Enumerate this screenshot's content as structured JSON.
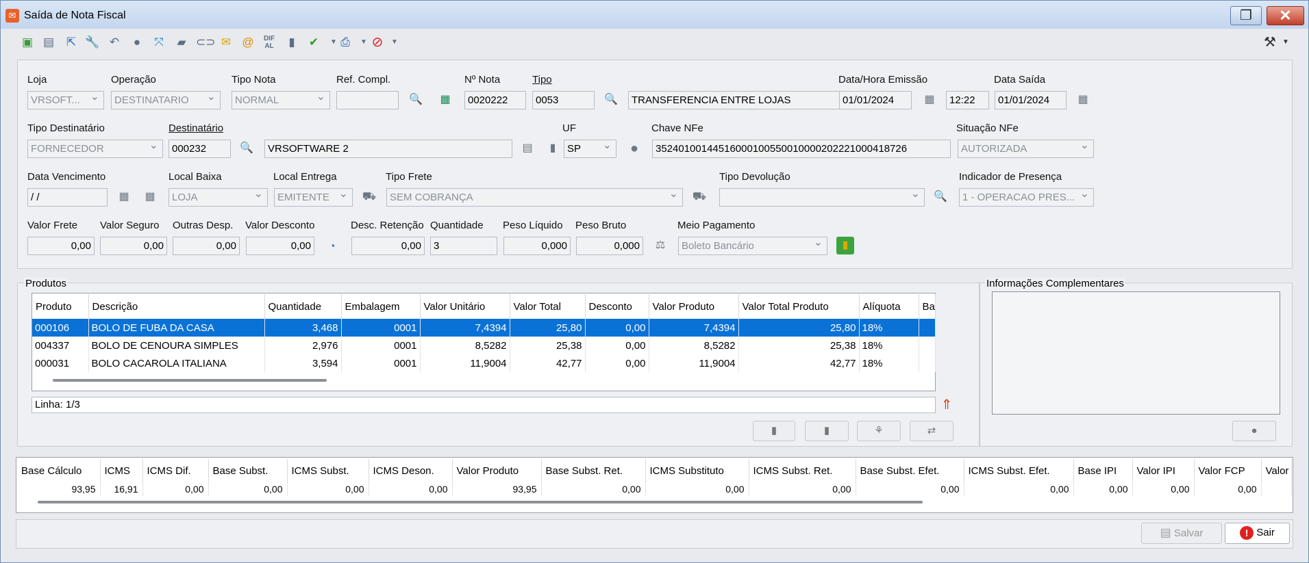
{
  "window": {
    "title": "Saída de Nota Fiscal"
  },
  "header": {
    "loja": {
      "label": "Loja",
      "value": "VRSOFT..."
    },
    "operacao": {
      "label": "Operação",
      "value": "DESTINATARIO"
    },
    "tipo_nota": {
      "label": "Tipo Nota",
      "value": "NORMAL"
    },
    "ref_compl": {
      "label": "Ref. Compl.",
      "value": ""
    },
    "numero_nota": {
      "label": "Nº Nota",
      "value": "0020222"
    },
    "tipo": {
      "label": "Tipo",
      "code": "0053",
      "description": "TRANSFERENCIA ENTRE LOJAS"
    },
    "data_hora_emissao": {
      "label": "Data/Hora Emissão",
      "date": "01/01/2024",
      "time": "12:22"
    },
    "data_saida": {
      "label": "Data Saída",
      "value": "01/01/2024"
    },
    "tipo_destinatario": {
      "label": "Tipo Destinatário",
      "value": "FORNECEDOR"
    },
    "destinatario": {
      "label": "Destinatário",
      "code": "000232",
      "name": "VRSOFTWARE 2"
    },
    "uf": {
      "label": "UF",
      "value": "SP"
    },
    "chave_nfe": {
      "label": "Chave NFe",
      "value": "35240100144516000100550010000202221000418726"
    },
    "situacao_nfe": {
      "label": "Situação NFe",
      "value": "AUTORIZADA"
    },
    "data_vencimento": {
      "label": "Data Vencimento",
      "value": " / /"
    },
    "local_baixa": {
      "label": "Local Baixa",
      "value": "LOJA"
    },
    "local_entrega": {
      "label": "Local Entrega",
      "value": "EMITENTE"
    },
    "tipo_frete": {
      "label": "Tipo Frete",
      "value": "SEM COBRANÇA"
    },
    "tipo_devolucao": {
      "label": "Tipo Devolução",
      "value": ""
    },
    "indicador_presenca": {
      "label": "Indicador de Presença",
      "value": "1 - OPERACAO PRES..."
    },
    "valor_frete": {
      "label": "Valor Frete",
      "value": "0,00"
    },
    "valor_seguro": {
      "label": "Valor Seguro",
      "value": "0,00"
    },
    "outras_desp": {
      "label": "Outras Desp.",
      "value": "0,00"
    },
    "valor_desconto": {
      "label": "Valor Desconto",
      "value": "0,00"
    },
    "desc_retencao": {
      "label": "Desc. Retenção",
      "value": "0,00"
    },
    "quantidade": {
      "label": "Quantidade",
      "value": "3"
    },
    "peso_liquido": {
      "label": "Peso Líquido",
      "value": "0,000"
    },
    "peso_bruto": {
      "label": "Peso Bruto",
      "value": "0,000"
    },
    "meio_pagamento": {
      "label": "Meio Pagamento",
      "value": "Boleto Bancário"
    }
  },
  "produtos": {
    "title": "Produtos",
    "columns": [
      "Produto",
      "Descrição",
      "Quantidade",
      "Embalagem",
      "Valor Unitário",
      "Valor Total",
      "Desconto",
      "Valor Produto",
      "Valor Total Produto",
      "Alíquota",
      "Bas"
    ],
    "rows": [
      [
        "000106",
        "BOLO DE FUBA DA CASA",
        "3,468",
        "0001",
        "7,4394",
        "25,80",
        "0,00",
        "7,4394",
        "25,80",
        "18%",
        ""
      ],
      [
        "004337",
        "BOLO DE CENOURA SIMPLES",
        "2,976",
        "0001",
        "8,5282",
        "25,38",
        "0,00",
        "8,5282",
        "25,38",
        "18%",
        ""
      ],
      [
        "000031",
        "BOLO CACAROLA ITALIANA",
        "3,594",
        "0001",
        "11,9004",
        "42,77",
        "0,00",
        "11,9004",
        "42,77",
        "18%",
        ""
      ]
    ],
    "status": "Linha: 1/3"
  },
  "informacoes": {
    "title": "Informações Complementares"
  },
  "totais": {
    "columns": [
      "Base Cálculo",
      "ICMS",
      "ICMS Dif.",
      "Base Subst.",
      "ICMS Subst.",
      "ICMS Deson.",
      "Valor Produto",
      "Base Subst. Ret.",
      "ICMS Substituto",
      "ICMS Subst. Ret.",
      "Base Subst. Efet.",
      "ICMS Subst. Efet.",
      "Base IPI",
      "Valor IPI",
      "Valor FCP",
      "Valor"
    ],
    "values": [
      "93,95",
      "16,91",
      "0,00",
      "0,00",
      "0,00",
      "0,00",
      "93,95",
      "0,00",
      "0,00",
      "0,00",
      "0,00",
      "0,00",
      "0,00",
      "0,00",
      "0,00",
      ""
    ]
  },
  "footer": {
    "save_label": "Salvar",
    "exit_label": "Sair"
  }
}
